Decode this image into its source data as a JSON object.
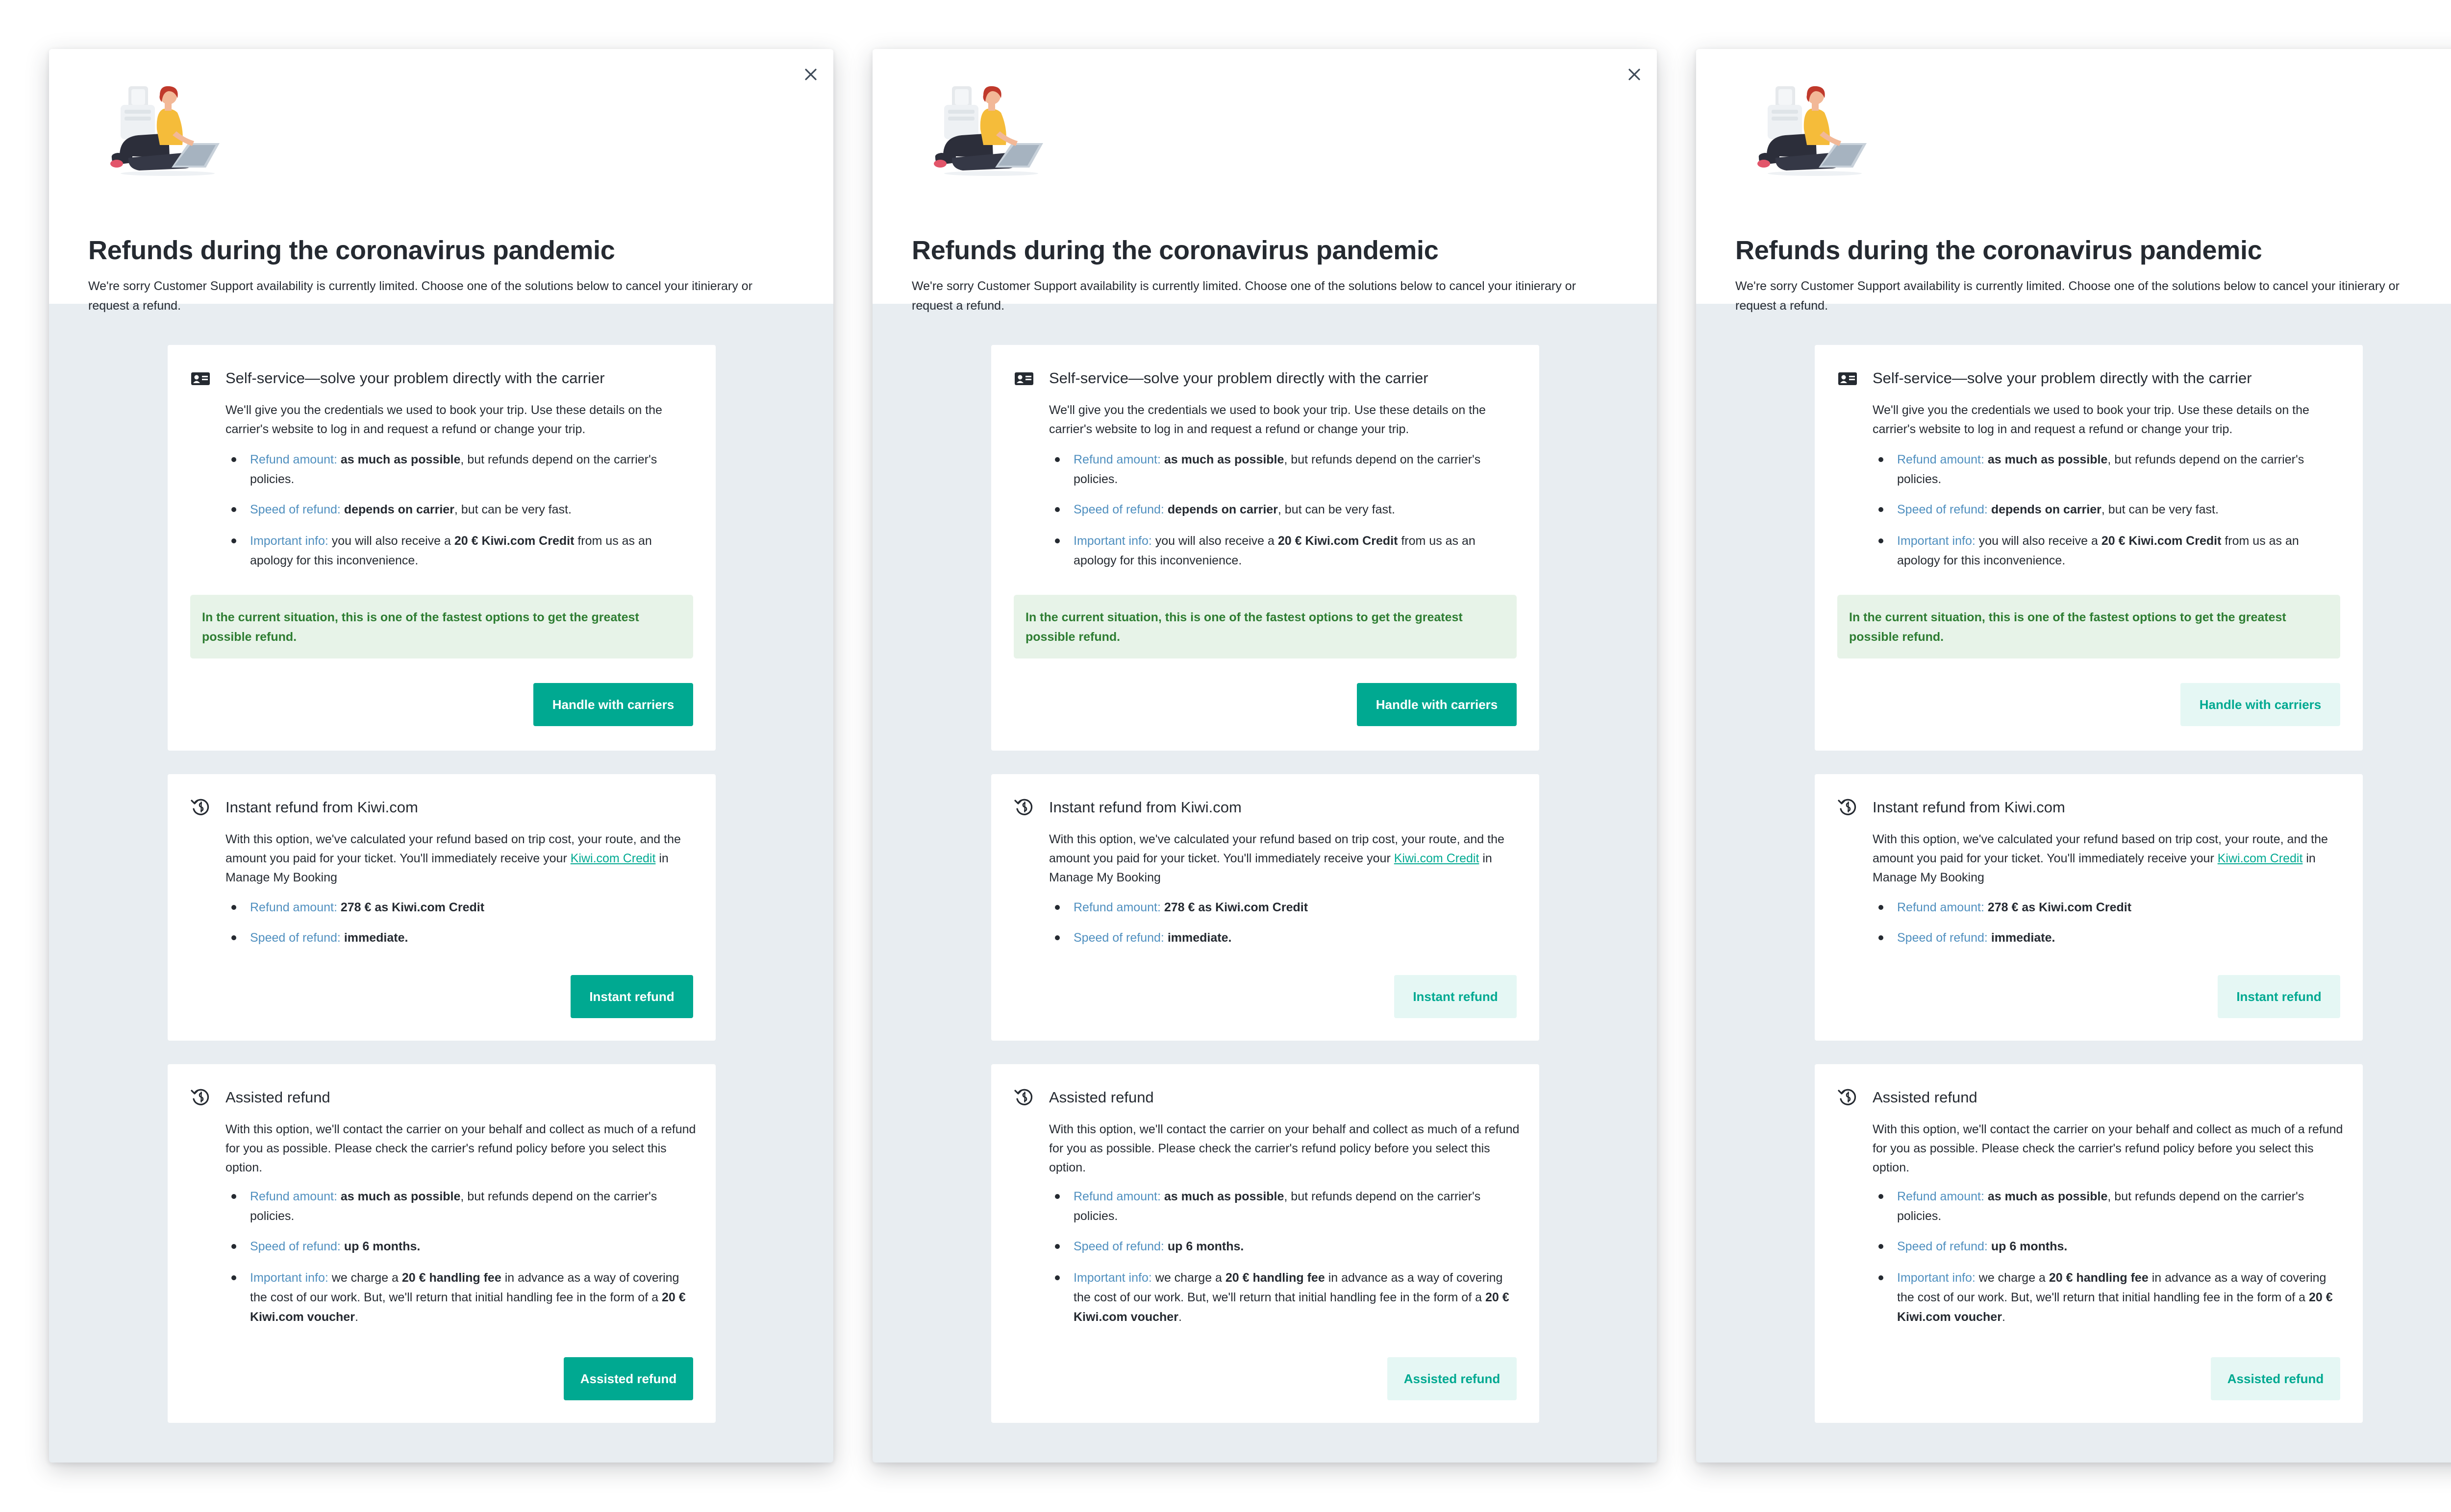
{
  "modal": {
    "title": "Refunds during the coronavirus pandemic",
    "subtitle": "We're sorry Customer Support availability is currently limited. Choose one of the solutions below to cancel your itinierary or request a refund."
  },
  "self_service": {
    "title": "Self-service—solve your problem directly with the carrier",
    "description": "We'll give you the credentials we used to book your trip. Use these details on the carrier's website to log in and request a refund or change your trip.",
    "refund_amount_label": "Refund amount:",
    "refund_amount_value": "as much as possible",
    "refund_amount_suffix": ", but refunds depend on the carrier's policies.",
    "speed_label": "Speed of refund:",
    "speed_value": "depends on carrier",
    "speed_suffix": ", but can be very fast.",
    "info_label": "Important info:",
    "info_prefix": " you will also receive a ",
    "info_value": "20 € Kiwi.com Credit",
    "info_suffix": " from us as an apology for this inconvenience.",
    "alert": "In the current situation, this is one of the fastest options to get the greatest possible refund.",
    "button": "Handle with carriers"
  },
  "instant": {
    "title": "Instant refund from Kiwi.com",
    "description_prefix": "With this option, we've calculated your refund based on trip cost, your route, and the amount you paid for your ticket. You'll immediately receive your ",
    "description_link": "Kiwi.com Credit",
    "description_suffix": " in Manage My Booking",
    "refund_amount_label": "Refund amount:",
    "refund_amount_value": "278 € as Kiwi.com Credit",
    "speed_label": "Speed of refund:",
    "speed_value": "immediate.",
    "button": "Instant refund"
  },
  "assisted": {
    "title": "Assisted refund",
    "description": "With this option, we'll contact the carrier on your behalf and collect as much of a refund for you as possible. Please check the carrier's refund policy before you select this option.",
    "refund_amount_label": "Refund amount:",
    "refund_amount_value": "as much as possible",
    "refund_amount_suffix": ", but refunds depend on the carrier's policies.",
    "speed_label": "Speed of refund:",
    "speed_value": "up 6 months.",
    "info_label": "Important info:",
    "info_prefix": " we charge a ",
    "info_value": "20 € handling fee",
    "info_middle": " in advance as a way of covering the cost of our work. But, we'll return that initial handling fee in the form of a ",
    "info_value2": "20 € Kiwi.com voucher",
    "info_suffix": ".",
    "button": "Assisted refund"
  },
  "variants": [
    {
      "handle_style": "primary",
      "instant_style": "primary",
      "assisted_style": "primary"
    },
    {
      "handle_style": "primary",
      "instant_style": "secondary",
      "assisted_style": "secondary"
    },
    {
      "handle_style": "secondary",
      "instant_style": "secondary",
      "assisted_style": "secondary"
    }
  ],
  "colors": {
    "primary": "#00a991",
    "secondary_bg": "#e5f7f4",
    "label": "#4f8fbf",
    "alert_bg": "#e7f3e8",
    "alert_text": "#2e7d32",
    "backdrop": "#e8edf1",
    "text": "#252a31"
  },
  "icons": {
    "close": "close-icon",
    "self_service": "id-card-icon",
    "instant": "refund-clock-icon",
    "assisted": "refund-clock-icon",
    "illustration": "woman-with-laptop-illustration"
  }
}
